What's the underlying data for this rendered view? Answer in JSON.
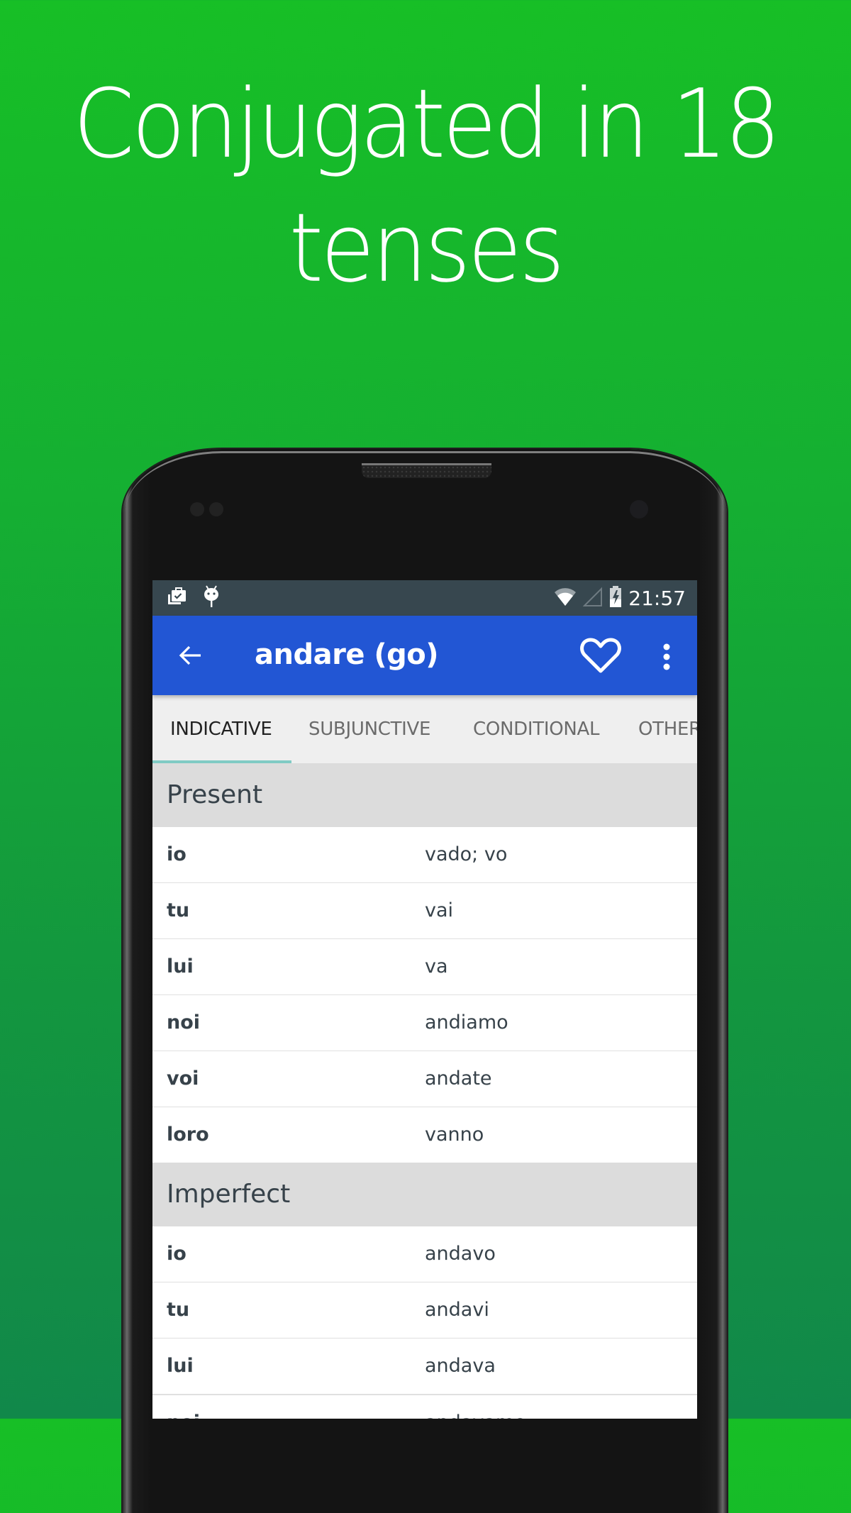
{
  "headline": {
    "line1": "Conjugated in 18",
    "line2": "tenses"
  },
  "status_bar": {
    "left_icons": [
      "briefcase-check-icon",
      "android-icon"
    ],
    "right_icons": [
      "wifi-icon",
      "cell-signal-icon",
      "battery-charging-icon"
    ],
    "time": "21:57"
  },
  "app_bar": {
    "back_icon": "arrow-back-icon",
    "title": "andare (go)",
    "favorite_icon": "heart-outline-icon",
    "more_icon": "more-vert-icon",
    "color": "#2256D4"
  },
  "tabs": [
    {
      "label": "INDICATIVE",
      "active": true
    },
    {
      "label": "SUBJUNCTIVE",
      "active": false
    },
    {
      "label": "CONDITIONAL",
      "active": false
    },
    {
      "label": "OTHER",
      "active": false
    }
  ],
  "tab_indicator_color": "#80CBC4",
  "sections": [
    {
      "title": "Present",
      "rows": [
        {
          "pronoun": "io",
          "form": "vado; vo"
        },
        {
          "pronoun": "tu",
          "form": "vai"
        },
        {
          "pronoun": "lui",
          "form": "va"
        },
        {
          "pronoun": "noi",
          "form": "andiamo"
        },
        {
          "pronoun": "voi",
          "form": "andate"
        },
        {
          "pronoun": "loro",
          "form": "vanno"
        }
      ]
    },
    {
      "title": "Imperfect",
      "rows": [
        {
          "pronoun": "io",
          "form": "andavo"
        },
        {
          "pronoun": "tu",
          "form": "andavi"
        },
        {
          "pronoun": "lui",
          "form": "andava"
        },
        {
          "pronoun": "noi",
          "form": "andavamo"
        }
      ]
    }
  ]
}
